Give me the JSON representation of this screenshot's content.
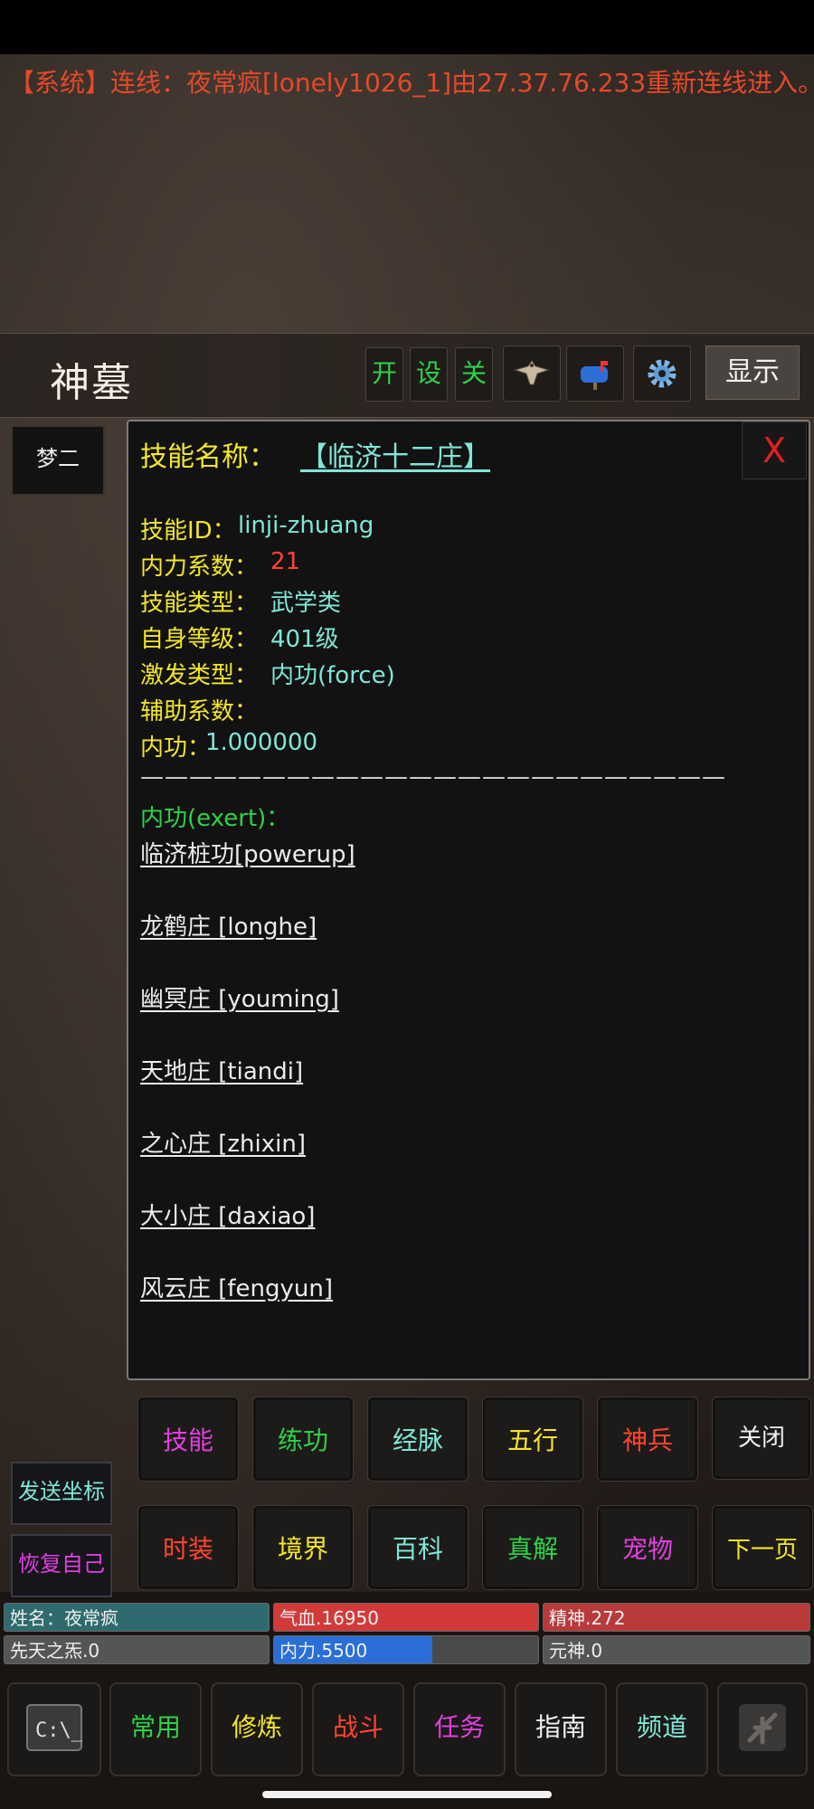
{
  "system_message": "【系统】连线：夜常疯[lonely1026_1]由27.37.76.233重新连线进入。",
  "title": "神墓",
  "top_buttons": {
    "open": "开",
    "settings": "设",
    "close": "关",
    "show": "显示"
  },
  "side_tab": "梦二",
  "panel": {
    "close_label": "X",
    "skill_name_label": "技能名称：",
    "skill_name_value": "【临济十二庄】",
    "skill_id_label": "技能ID：",
    "skill_id_value": "linji-zhuang",
    "coef_label": "内力系数：",
    "coef_value": "21",
    "type_label": "技能类型：",
    "type_value": "武学类",
    "level_label": "自身等级：",
    "level_value": "401级",
    "excite_label": "激发类型：",
    "excite_value": "内功(force)",
    "assist_label": "辅助系数：",
    "neigong_label": "内功：",
    "neigong_value": "1.000000",
    "separator": "————————————————————————",
    "exert_label": "内功(exert)：",
    "exert_items": [
      "临济桩功[powerup]",
      "龙鹤庄 [longhe]",
      "幽冥庄 [youming]",
      "天地庄 [tiandi]",
      "之心庄 [zhixin]",
      "大小庄 [daxiao]",
      "风云庄 [fengyun]"
    ]
  },
  "grid_row1": [
    "技能",
    "练功",
    "经脉",
    "五行",
    "神兵",
    "关闭"
  ],
  "grid_row2": [
    "时装",
    "境界",
    "百科",
    "真解",
    "宠物",
    "下一页"
  ],
  "side_buttons": {
    "send_coords": "发送坐标",
    "restore_self": "恢复自己"
  },
  "stats": {
    "name": "姓名：夜常疯",
    "qixue": "气血.16950",
    "jingshen": "精神.272",
    "xiantian": "先天之炁.0",
    "neili": "内力.5500",
    "yuanshen": "元神.0",
    "neili_fill": 0.6
  },
  "nav": [
    "常用",
    "修炼",
    "战斗",
    "任务",
    "指南",
    "频道"
  ],
  "colors": {
    "system_red": "#e34a2a",
    "label_yellow": "#f4e62a",
    "value_cyan": "#7fe6d8",
    "accent_green": "#2fd14a",
    "magenta": "#e040e0",
    "hp_red": "#d23a3a",
    "mp_blue": "#2b6fd6"
  }
}
